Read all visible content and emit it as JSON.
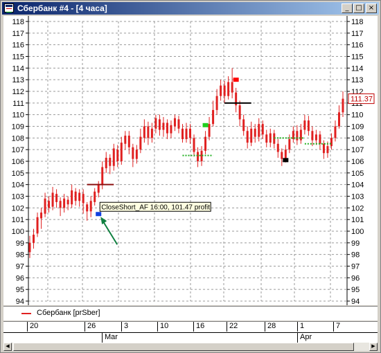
{
  "window": {
    "title": "Сбербанк #4 - [4 часа]",
    "minimize_glyph": "_",
    "restore_glyph": "□",
    "close_glyph": "×"
  },
  "chart_data": {
    "type": "candlestick",
    "y_axis": {
      "min": 94,
      "max": 118,
      "ticks": [
        94,
        95,
        96,
        97,
        98,
        99,
        100,
        101,
        102,
        103,
        104,
        105,
        106,
        107,
        108,
        109,
        110,
        111,
        112,
        113,
        114,
        115,
        116,
        117,
        118
      ],
      "shown_left": true,
      "shown_right": true
    },
    "grid": true,
    "last_price_label": "111.37",
    "tooltip": "CloseShort_AF 16:00, 101.47 profit",
    "series_color": "#e02020",
    "candles": [
      [
        98.2,
        99.0,
        97.7,
        99.6
      ],
      [
        99.0,
        99.7,
        98.5,
        100.2
      ],
      [
        99.8,
        101.2,
        99.5,
        101.6
      ],
      [
        101.1,
        101.6,
        100.2,
        102.0
      ],
      [
        101.5,
        102.8,
        101.2,
        103.3
      ],
      [
        102.6,
        102.0,
        101.6,
        103.0
      ],
      [
        102.1,
        103.3,
        101.8,
        103.8
      ],
      [
        103.2,
        102.5,
        102.0,
        103.6
      ],
      [
        102.6,
        102.0,
        101.3,
        102.9
      ],
      [
        102.0,
        102.8,
        101.6,
        103.2
      ],
      [
        102.7,
        102.3,
        101.8,
        103.0
      ],
      [
        102.3,
        103.5,
        102.0,
        104.0
      ],
      [
        103.4,
        102.6,
        102.2,
        103.7
      ],
      [
        102.6,
        103.3,
        102.1,
        103.6
      ],
      [
        103.2,
        102.4,
        101.5,
        103.6
      ],
      [
        102.3,
        101.7,
        100.9,
        102.5
      ],
      [
        101.7,
        102.6,
        101.2,
        103.0
      ],
      [
        102.5,
        103.4,
        102.2,
        103.7
      ],
      [
        103.3,
        104.0,
        102.9,
        104.3
      ],
      [
        104.0,
        105.5,
        103.6,
        106.0
      ],
      [
        105.4,
        106.3,
        105.0,
        106.8
      ],
      [
        106.3,
        105.6,
        104.9,
        106.6
      ],
      [
        105.6,
        107.1,
        105.2,
        107.5
      ],
      [
        107.0,
        106.0,
        105.5,
        107.4
      ],
      [
        106.0,
        107.6,
        105.7,
        108.1
      ],
      [
        107.5,
        108.2,
        107.0,
        108.6
      ],
      [
        108.2,
        107.2,
        106.6,
        108.6
      ],
      [
        107.2,
        106.2,
        105.5,
        107.5
      ],
      [
        106.2,
        107.0,
        105.8,
        107.4
      ],
      [
        107.0,
        108.1,
        106.7,
        108.8
      ],
      [
        108.0,
        109.0,
        107.6,
        109.6
      ],
      [
        109.0,
        108.0,
        107.4,
        109.4
      ],
      [
        108.0,
        108.8,
        107.6,
        109.3
      ],
      [
        108.8,
        109.7,
        108.4,
        110.0
      ],
      [
        109.6,
        108.7,
        108.2,
        110.0
      ],
      [
        108.7,
        109.3,
        108.1,
        109.8
      ],
      [
        109.3,
        108.4,
        107.9,
        109.6
      ],
      [
        108.4,
        109.1,
        108.0,
        109.5
      ],
      [
        109.0,
        109.7,
        108.6,
        110.0
      ],
      [
        109.6,
        108.8,
        108.4,
        109.9
      ],
      [
        108.8,
        107.9,
        107.6,
        109.2
      ],
      [
        107.9,
        108.8,
        107.6,
        109.3
      ],
      [
        108.8,
        108.0,
        107.5,
        109.2
      ],
      [
        108.0,
        106.8,
        106.4,
        108.3
      ],
      [
        106.8,
        106.0,
        105.5,
        107.2
      ],
      [
        106.0,
        106.9,
        105.6,
        107.3
      ],
      [
        106.9,
        108.1,
        106.6,
        108.6
      ],
      [
        108.1,
        109.2,
        107.8,
        109.8
      ],
      [
        109.2,
        110.4,
        109.0,
        111.2
      ],
      [
        110.4,
        111.6,
        110.0,
        112.2
      ],
      [
        111.6,
        112.5,
        111.2,
        113.0
      ],
      [
        112.5,
        111.6,
        111.0,
        112.9
      ],
      [
        111.6,
        112.8,
        111.3,
        113.3
      ],
      [
        112.8,
        111.9,
        111.4,
        114.0
      ],
      [
        111.9,
        110.8,
        110.2,
        112.3
      ],
      [
        110.8,
        109.6,
        109.0,
        111.2
      ],
      [
        109.6,
        108.6,
        108.2,
        110.0
      ],
      [
        108.6,
        107.6,
        107.1,
        109.0
      ],
      [
        107.6,
        108.8,
        107.3,
        109.4
      ],
      [
        108.8,
        108.1,
        107.6,
        109.2
      ],
      [
        108.1,
        109.2,
        107.7,
        109.7
      ],
      [
        109.2,
        108.3,
        107.9,
        109.5
      ],
      [
        108.3,
        107.6,
        107.2,
        108.7
      ],
      [
        107.6,
        108.4,
        107.2,
        108.8
      ],
      [
        108.4,
        107.5,
        107.1,
        108.7
      ],
      [
        107.5,
        106.8,
        106.3,
        107.9
      ],
      [
        106.8,
        106.2,
        105.6,
        107.1
      ],
      [
        106.2,
        107.0,
        105.9,
        107.4
      ],
      [
        107.0,
        107.9,
        106.7,
        108.3
      ],
      [
        107.9,
        108.6,
        107.6,
        109.0
      ],
      [
        108.6,
        107.8,
        107.4,
        109.1
      ],
      [
        107.8,
        108.7,
        107.5,
        109.2
      ],
      [
        108.7,
        109.5,
        108.3,
        110.0
      ],
      [
        109.5,
        108.6,
        108.2,
        109.9
      ],
      [
        108.6,
        107.8,
        107.3,
        109.0
      ],
      [
        107.8,
        108.3,
        107.4,
        108.7
      ],
      [
        108.3,
        107.5,
        107.0,
        108.6
      ],
      [
        107.5,
        106.7,
        106.2,
        107.8
      ],
      [
        106.7,
        107.3,
        106.3,
        107.7
      ],
      [
        107.3,
        108.0,
        107.0,
        108.4
      ],
      [
        108.0,
        109.0,
        107.7,
        109.5
      ],
      [
        109.0,
        110.2,
        108.8,
        110.8
      ],
      [
        110.2,
        111.37,
        109.8,
        112.0
      ]
    ],
    "markers": [
      {
        "type": "segment",
        "color": "#8b1010",
        "y": 104.0,
        "i1": 15,
        "i2": 22
      },
      {
        "type": "segment",
        "color": "#000000",
        "y": 111.0,
        "i1": 51,
        "i2": 58
      },
      {
        "type": "dotted",
        "color": "#20b020",
        "y": 106.5,
        "i1": 40,
        "i2": 48
      },
      {
        "type": "dotted",
        "color": "#20b020",
        "y": 108.0,
        "i1": 64,
        "i2": 72
      },
      {
        "type": "dotted",
        "color": "#20b020",
        "y": 107.5,
        "i1": 72,
        "i2": 79
      },
      {
        "type": "block",
        "color": "#1040e0",
        "y": 101.47,
        "i": 18
      },
      {
        "type": "block",
        "color": "#20d020",
        "y": 109.1,
        "i": 46
      },
      {
        "type": "block",
        "color": "#ff0000",
        "y": 113.0,
        "i": 54
      },
      {
        "type": "block",
        "color": "#000000",
        "y": 106.1,
        "i": 67
      }
    ]
  },
  "legend": {
    "label": "Сбербанк [prSber]"
  },
  "time_axis": {
    "days": [
      "20",
      "26",
      "3",
      "10",
      "16",
      "22",
      "28",
      "1",
      "7"
    ],
    "months": [
      "Mar",
      "Apr"
    ]
  }
}
